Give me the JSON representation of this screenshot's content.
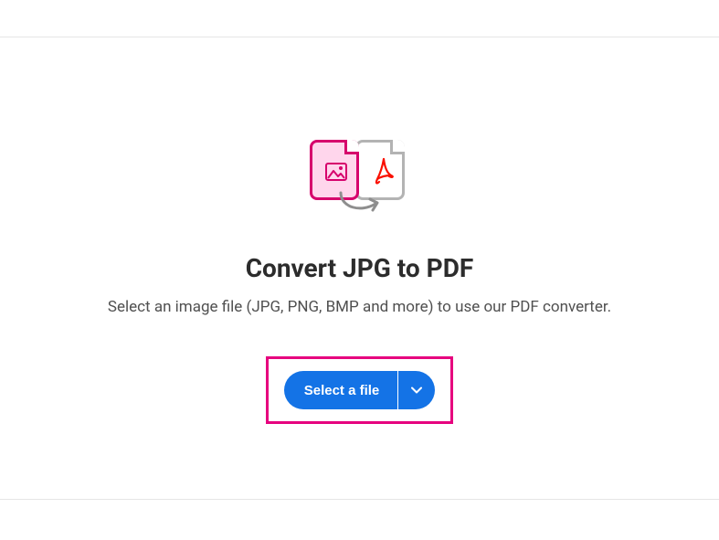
{
  "page": {
    "title": "Convert JPG to PDF",
    "subtitle": "Select an image file (JPG, PNG, BMP and more) to use our PDF converter."
  },
  "button": {
    "select_label": "Select a file"
  }
}
